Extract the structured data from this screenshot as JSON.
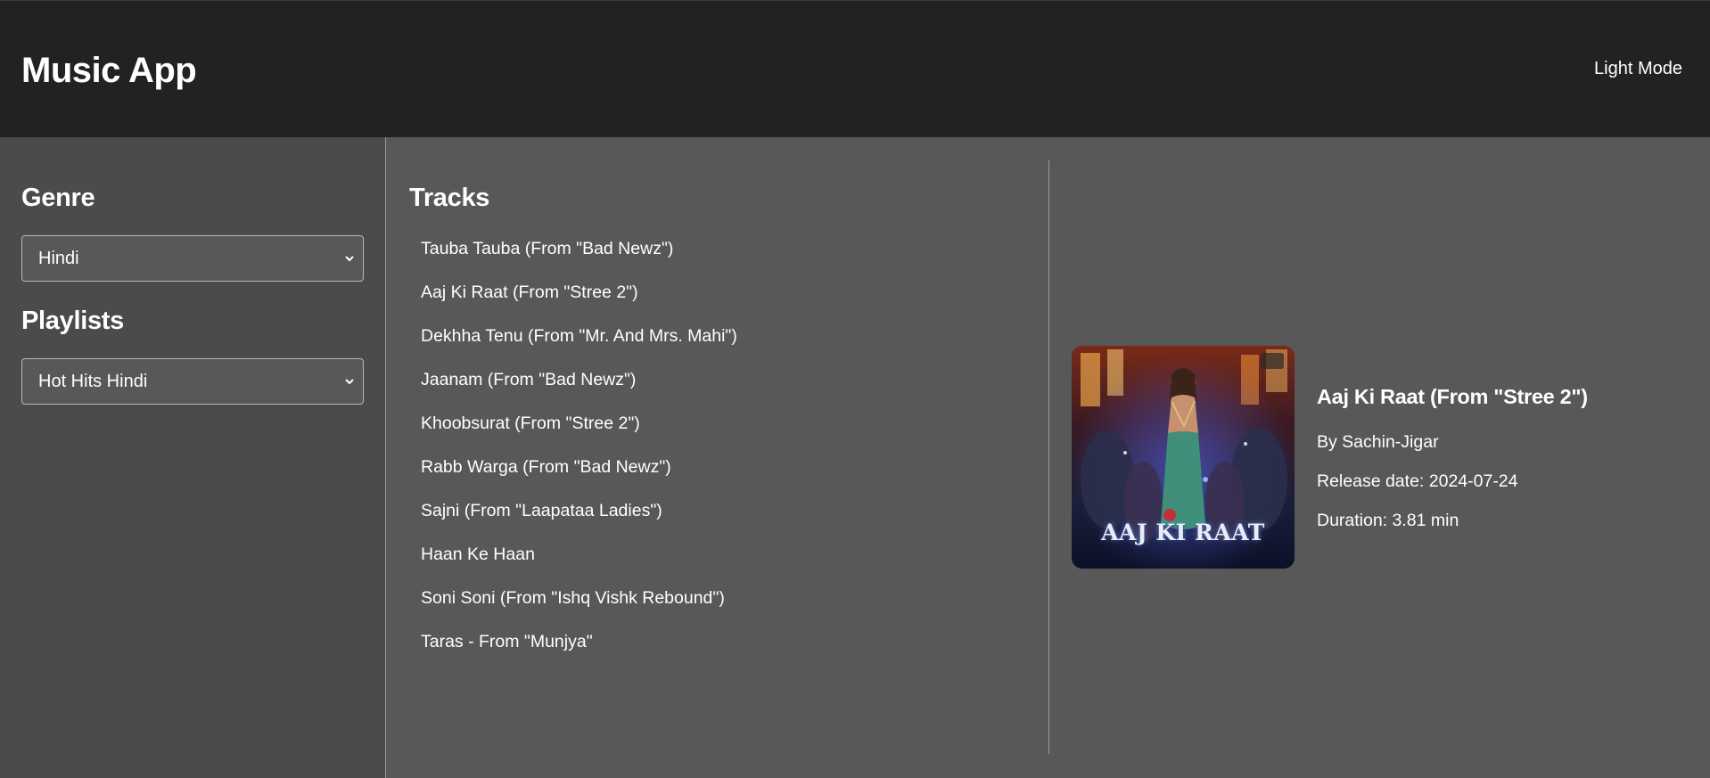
{
  "header": {
    "title": "Music App",
    "mode_toggle_label": "Light Mode"
  },
  "sidebar": {
    "genre_heading": "Genre",
    "genre_selected": "Hindi",
    "playlists_heading": "Playlists",
    "playlist_selected": "Hot Hits Hindi"
  },
  "tracks": {
    "heading": "Tracks",
    "items": [
      "Tauba Tauba (From \"Bad Newz\")",
      "Aaj Ki Raat (From \"Stree 2\")",
      "Dekhha Tenu (From \"Mr. And Mrs. Mahi\")",
      "Jaanam (From \"Bad Newz\")",
      "Khoobsurat (From \"Stree 2\")",
      "Rabb Warga (From \"Bad Newz\")",
      "Sajni (From \"Laapataa Ladies\")",
      "Haan Ke Haan",
      "Soni Soni (From \"Ishq Vishk Rebound\")",
      "Taras - From \"Munjya\""
    ]
  },
  "details": {
    "album_art_caption": "AAJ KI RAAT",
    "title": "Aaj Ki Raat (From \"Stree 2\")",
    "artist": "By Sachin-Jigar",
    "release_date": "Release date: 2024-07-24",
    "duration": "Duration: 3.81 min"
  },
  "colors": {
    "header_bg": "#222222",
    "sidebar_bg": "#4b4b4b",
    "content_bg": "#585858",
    "text": "#ffffff",
    "divider": "#9a9a9a"
  }
}
